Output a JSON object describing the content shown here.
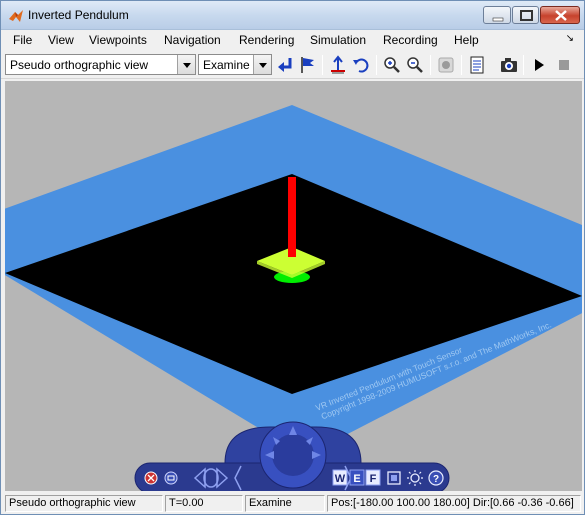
{
  "window": {
    "title": "Inverted Pendulum"
  },
  "menu": {
    "items": [
      "File",
      "View",
      "Viewpoints",
      "Navigation",
      "Rendering",
      "Simulation",
      "Recording",
      "Help"
    ],
    "corner": "↘"
  },
  "toolbar": {
    "viewpoint_select": "Pseudo orthographic view",
    "navigation_select": "Examine",
    "buttons": [
      "return-to-viewpoint-icon",
      "create-viewpoint-icon",
      "straighten-up-icon",
      "undo-move-icon",
      "zoom-in-icon",
      "zoom-out-icon",
      "record-icon",
      "capture-frame-icon",
      "snapshot-camera-icon",
      "play-icon",
      "stop-icon"
    ]
  },
  "scene": {
    "floor_color": "#000000",
    "border_color": "#4a90e0",
    "background_color": "#b6b6b6",
    "pendulum_rod_color": "#ff0000",
    "cart_color": "#ccff33",
    "base_color": "#00ee00",
    "watermark_line1": "VR Inverted Pendulum with Touch Sensor",
    "watermark_line2": "Copyright 1998-2009 HUMUSOFT s.r.o. and The MathWorks, Inc."
  },
  "navpanel": {
    "left_buttons": [
      "close-panel-icon",
      "minimize-panel-icon"
    ],
    "walk_label": "W",
    "examine_label": "E",
    "fly_label": "F",
    "right_buttons": [
      "fit-view-icon",
      "headlight-icon",
      "help-icon"
    ]
  },
  "status": {
    "viewpoint": "Pseudo orthographic view",
    "time": "T=0.00",
    "navigation": "Examine",
    "position": "Pos:[-180.00 100.00 180.00] Dir:[0.66 -0.36 -0.66]"
  }
}
